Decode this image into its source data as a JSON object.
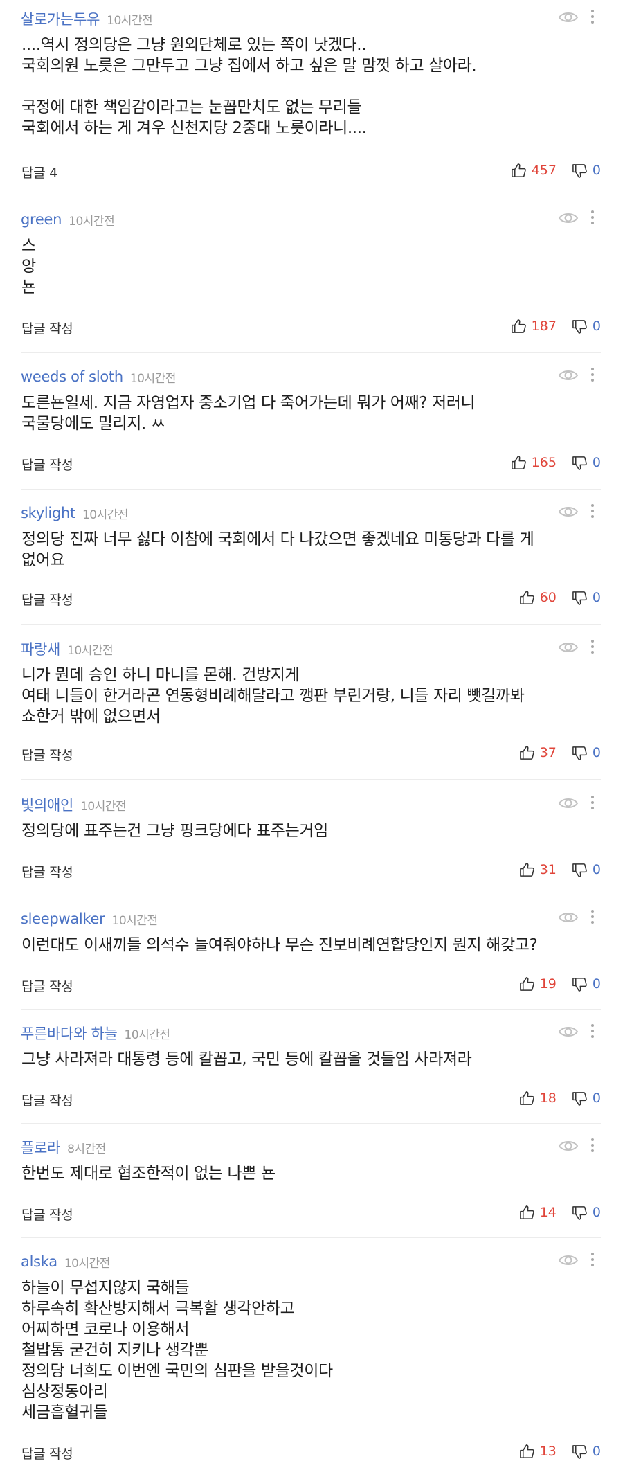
{
  "colors": {
    "nickname": "#4a72c4",
    "time": "#9a9a9a",
    "like": "#e0453a",
    "dislike": "#4a72c4",
    "divider": "#ececec"
  },
  "comments": [
    {
      "nickname": "살로가는두유",
      "time": "10시간전",
      "text": "....역시 정의당은 그냥 원외단체로 있는 쪽이 낫겠다..\n국회의원 노릇은 그만두고 그냥 집에서 하고 싶은 말 맘껏 하고 살아라.\n\n국정에 대한 책임감이라고는 눈꼽만치도 없는 무리들\n국회에서 하는 게 겨우 신천지당 2중대 노릇이라니....",
      "reply": "답글 4",
      "likes": "457",
      "dislikes": "0"
    },
    {
      "nickname": "green",
      "time": "10시간전",
      "text": "스\n앙\n뇬",
      "reply": "답글 작성",
      "likes": "187",
      "dislikes": "0"
    },
    {
      "nickname": "weeds of sloth",
      "time": "10시간전",
      "text": "도른뇬일세. 지금 자영업자 중소기업 다 죽어가는데 뭐가 어째? 저러니\n국물당에도 밀리지. ㅆ",
      "reply": "답글 작성",
      "likes": "165",
      "dislikes": "0"
    },
    {
      "nickname": "skylight",
      "time": "10시간전",
      "text": "정의당 진짜 너무 싫다 이참에 국회에서 다 나갔으면 좋겠네요 미통당과 다를 게\n없어요",
      "reply": "답글 작성",
      "likes": "60",
      "dislikes": "0"
    },
    {
      "nickname": "파랑새",
      "time": "10시간전",
      "text": "니가 뭔데 승인 하니 마니를 몬해. 건방지게\n여태 니들이 한거라곤 연동형비례해달라고 깽판 부린거랑, 니들 자리 뺏길까봐\n쇼한거 밖에 없으면서",
      "reply": "답글 작성",
      "likes": "37",
      "dislikes": "0"
    },
    {
      "nickname": "빛의애인",
      "time": "10시간전",
      "text": "정의당에 표주는건 그냥 핑크당에다 표주는거임",
      "reply": "답글 작성",
      "likes": "31",
      "dislikes": "0"
    },
    {
      "nickname": "sleepwalker",
      "time": "10시간전",
      "text": "이런대도 이새끼들 의석수 늘여줘야하나 무슨 진보비례연합당인지 뭔지 해갖고?",
      "reply": "답글 작성",
      "likes": "19",
      "dislikes": "0"
    },
    {
      "nickname": "푸른바다와 하늘",
      "time": "10시간전",
      "text": "그냥 사라져라 대통령 등에 칼꼽고, 국민 등에 칼꼽을 것들임 사라져라",
      "reply": "답글 작성",
      "likes": "18",
      "dislikes": "0"
    },
    {
      "nickname": "플로라",
      "time": "8시간전",
      "text": "한번도 제대로 협조한적이 없는 나쁜 뇬",
      "reply": "답글 작성",
      "likes": "14",
      "dislikes": "0"
    },
    {
      "nickname": "alska",
      "time": "10시간전",
      "text": "하늘이 무섭지않지 국해들\n하루속히 확산방지해서 극복할 생각안하고\n어찌하면 코로나 이용해서\n철밥통 굳건히 지키나 생각뿐\n정의당 너희도 이번엔 국민의 심판을 받을것이다\n심상정동아리\n세금흡혈귀들",
      "reply": "답글 작성",
      "likes": "13",
      "dislikes": "0"
    }
  ]
}
